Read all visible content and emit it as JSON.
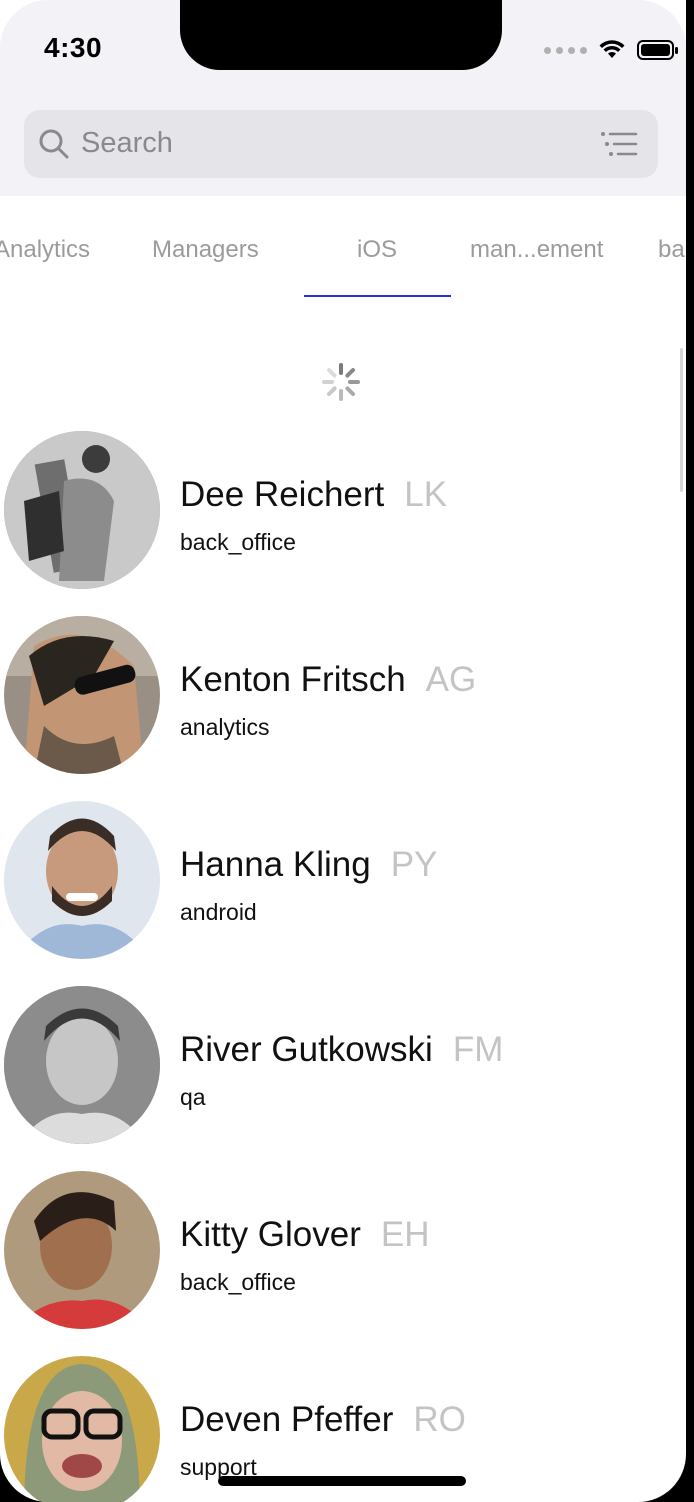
{
  "status_bar": {
    "time": "4:30"
  },
  "search": {
    "placeholder": "Search"
  },
  "tabs": [
    {
      "label": "Analytics",
      "selected": false
    },
    {
      "label": "Managers",
      "selected": false
    },
    {
      "label": "iOS",
      "selected": true
    },
    {
      "label": "man...ement",
      "selected": false
    },
    {
      "label": "ba",
      "selected": false
    }
  ],
  "colors": {
    "accent": "#2432d6",
    "code_gray": "#c4c4c4",
    "tab_gray": "#9b9b9b"
  },
  "employees": [
    {
      "name": "Dee Reichert",
      "code": "LK",
      "department": "back_office"
    },
    {
      "name": "Kenton Fritsch",
      "code": "AG",
      "department": "analytics"
    },
    {
      "name": "Hanna Kling",
      "code": "PY",
      "department": "android"
    },
    {
      "name": "River Gutkowski",
      "code": "FM",
      "department": "qa"
    },
    {
      "name": "Kitty Glover",
      "code": "EH",
      "department": "back_office"
    },
    {
      "name": "Deven Pfeffer",
      "code": "RO",
      "department": "support"
    }
  ]
}
